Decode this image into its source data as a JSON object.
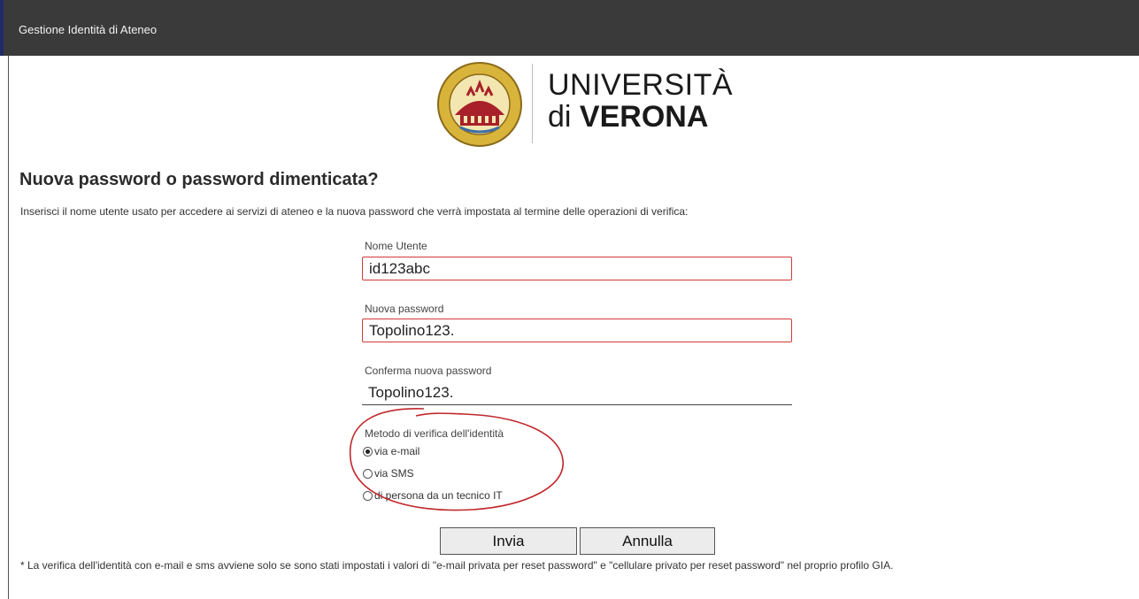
{
  "header": {
    "title": "Gestione Identità di Ateneo"
  },
  "logo": {
    "line1": "UNIVERSITÀ",
    "line2_prefix": "di ",
    "line2_bold": "VERONA"
  },
  "page": {
    "heading": "Nuova password o password dimenticata?",
    "intro": "Inserisci il nome utente usato per accedere ai servizi di ateneo e la nuova password che verrà impostata al termine delle operazioni di verifica:"
  },
  "form": {
    "username": {
      "label": "Nome Utente",
      "value": "id123abc"
    },
    "new_password": {
      "label": "Nuova password",
      "value": "Topolino123."
    },
    "confirm_password": {
      "label": "Conferma nuova password",
      "value": "Topolino123."
    },
    "verification": {
      "label": "Metodo di verifica dell'identità",
      "options": [
        {
          "label": "via e-mail",
          "checked": true
        },
        {
          "label": "via SMS",
          "checked": false
        },
        {
          "label": "di persona da un tecnico IT",
          "checked": false
        }
      ]
    },
    "buttons": {
      "send": "Invia",
      "cancel": "Annulla"
    }
  },
  "footnote": "* La verifica dell'identità con e-mail e sms avviene solo se sono stati impostati i valori di \"e-mail privata per reset password\" e \"cellulare privato per reset password\" nel proprio profilo GIA.",
  "colors": {
    "topbar": "#3a3a3a",
    "input_error_border": "#d13a3a",
    "annotation": "#c0282d",
    "seal_gold": "#d9b43a",
    "seal_red": "#a8202a"
  },
  "icons": {
    "seal": "university-seal-icon"
  }
}
